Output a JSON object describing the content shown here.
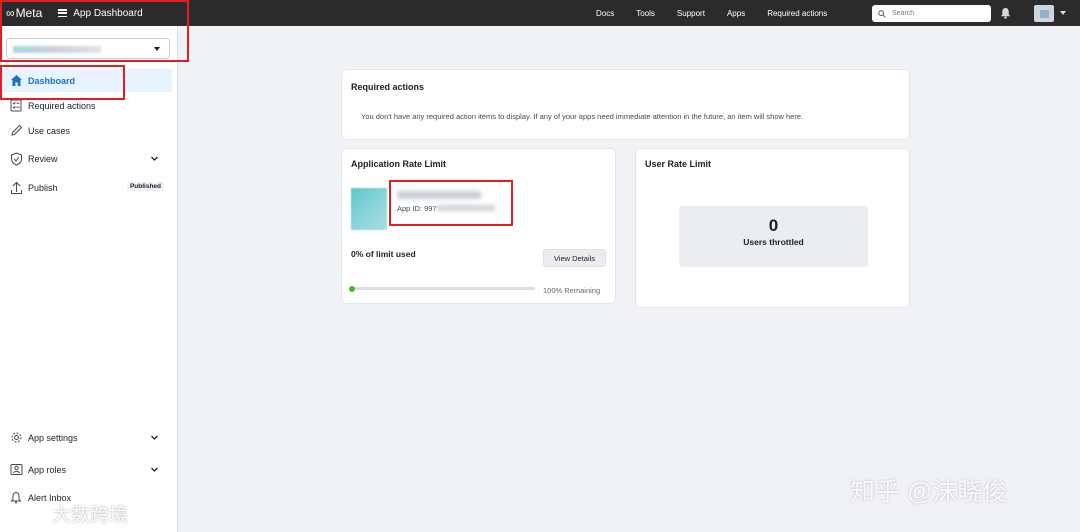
{
  "topbar": {
    "logo_text": "Meta",
    "app_title": "App Dashboard",
    "nav": [
      "Docs",
      "Tools",
      "Support",
      "Apps",
      "Required actions"
    ],
    "search_placeholder": "Search"
  },
  "sidebar": {
    "items": [
      {
        "label": "Dashboard",
        "icon": "home-icon",
        "active": true
      },
      {
        "label": "Required actions",
        "icon": "checklist-icon"
      },
      {
        "label": "Use cases",
        "icon": "pencil-icon"
      },
      {
        "label": "Review",
        "icon": "shield-check-icon",
        "expandable": true
      },
      {
        "label": "Publish",
        "icon": "upload-icon",
        "badge": "Published"
      }
    ],
    "bottom_items": [
      {
        "label": "App settings",
        "icon": "gear-icon",
        "expandable": true
      },
      {
        "label": "App roles",
        "icon": "person-badge-icon",
        "expandable": true
      },
      {
        "label": "Alert Inbox",
        "icon": "bell-icon"
      }
    ]
  },
  "required_actions": {
    "title": "Required actions",
    "message": "You don't have any required action items to display. If any of your apps need immediate attention in the future, an item will show here."
  },
  "app_rate_limit": {
    "title": "Application Rate Limit",
    "app_id_label": "App ID: 997",
    "limit_used": "0% of limit used",
    "view_details": "View Details",
    "remaining": "100% Remaining",
    "used_fraction": 0.0
  },
  "user_rate_limit": {
    "title": "User Rate Limit",
    "count": "0",
    "label": "Users throttled"
  },
  "watermarks": {
    "left": "大数跨境",
    "right": "知乎 @沫晓俊"
  },
  "colors": {
    "topbar": "#2b2b2b",
    "active_bg": "#e7f3ff",
    "active_text": "#1a73c8",
    "highlight_box": "#e02020",
    "progress": "#42b72a"
  }
}
